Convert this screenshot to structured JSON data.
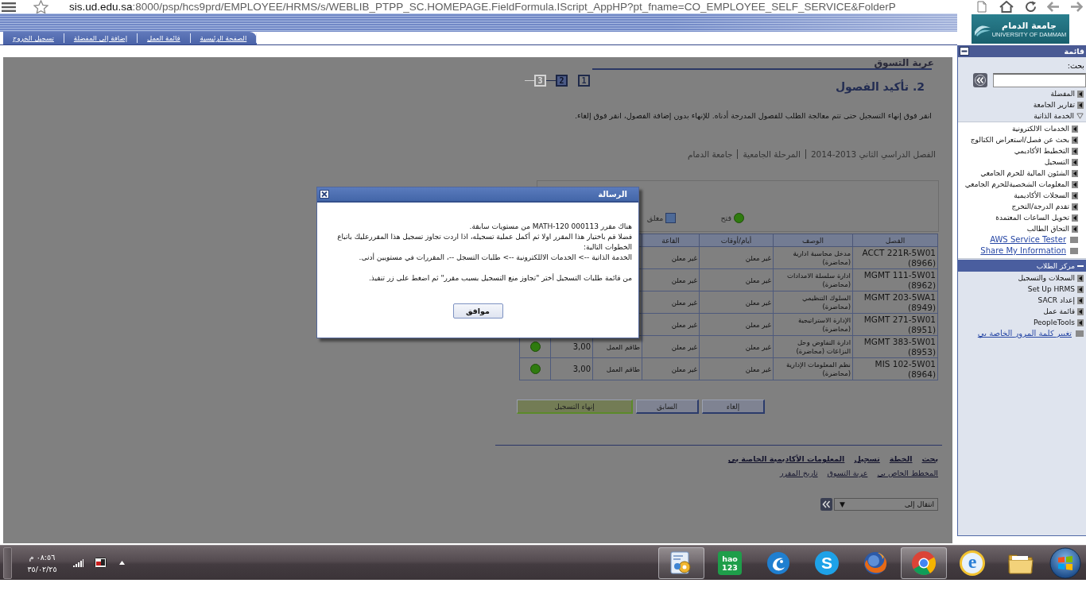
{
  "browser": {
    "url_host": "sis.ud.edu.sa",
    "url_path": ":8000/psp/hcs9prd/EMPLOYEE/HRMS/s/WEBLIB_PTPP_SC.HOMEPAGE.FieldFormula.IScript_AppHP?pt_fname=CO_EMPLOYEE_SELF_SERVICE&FolderP"
  },
  "header": {
    "logo": {
      "text": "جامعة الدمام",
      "subtitle": "UNIVERSITY OF DAMMAM"
    },
    "nav_links": [
      "الصفحة الرئيسية",
      "قائمة العمل",
      "إضافة إلى المفضلة",
      "تسجيل الخروج"
    ]
  },
  "page": {
    "title": "عربة التسوق",
    "heading": "2. تأكيد الفصول",
    "steps": [
      {
        "label": "1",
        "selected": false,
        "disabled": false
      },
      {
        "label": "2",
        "selected": true,
        "disabled": false
      },
      {
        "label": "3",
        "selected": false,
        "disabled": true
      }
    ],
    "instructions": "انقر فوق إنهاء التسجيل حتى تتم معالجة الطلب للفصول المدرجة أدناه. للإنهاء بدون إضافة الفصول، انقر فوق إلغاء.",
    "term": [
      "الفصل الدراسي الثاني 2013-2014",
      "المرحلة الجامعية",
      "جامعة الدمام"
    ],
    "legend": [
      {
        "kind": "open",
        "label": "فتح"
      },
      {
        "kind": "closed",
        "label": "مغلق"
      }
    ],
    "table": {
      "columns": [
        "الفصل",
        "الوصف",
        "أيام/أوقات",
        "القاعة"
      ],
      "rows": [
        {
          "class": "ACCT 221R-5W01 (8966)",
          "description": "مدخل محاسبة ادارية (محاضرة)",
          "days_times": "غير معلن",
          "room": "غير معلن"
        },
        {
          "class": "MGMT 111-5W01 (8962)",
          "description": "ادارة سلسلة الامدادات (محاضرة)",
          "days_times": "غير معلن",
          "room": "غير معلن"
        },
        {
          "class": "MGMT 203-5WA1 (8949)",
          "description": "السلوك التنظيمي (محاضرة)",
          "days_times": "غير معلن",
          "room": "غير معلن"
        },
        {
          "class": "MGMT 271-5W01 (8951)",
          "description": "الإدارة الاستراتيجية (محاضرة)",
          "days_times": "غير معلن",
          "room": "غير معلن"
        },
        {
          "class": "MGMT 383-5W01 (8953)",
          "description": "ادارة التفاوض وحل النزاعات (محاضرة)",
          "days_times": "غير معلن",
          "room": "غير معلن",
          "column_5": "طاقم العمل",
          "column_6": "3,00",
          "open": true
        },
        {
          "class": "MIS 102-5W01 (8964)",
          "description": "نظم المعلومات الإدارية (محاضرة)",
          "days_times": "غير معلن",
          "room": "غير معلن",
          "column_5": "طاقم العمل",
          "column_6": "3,00",
          "open": true
        }
      ]
    },
    "buttons": [
      {
        "label": "إلغاء",
        "kind": "secondary"
      },
      {
        "label": "السابق",
        "kind": "secondary"
      },
      {
        "label": "إنهاء التسجيل",
        "kind": "primary"
      }
    ],
    "link_rows": [
      {
        "kind": "bold",
        "links": [
          "بحث",
          "الخطة",
          "تسجيل",
          "المعلومات الأكاديمية الخاصة بي"
        ]
      },
      {
        "kind": "plain",
        "links": [
          "المخطط الخاص بي",
          "عربة التسوق",
          "تاريخ المقرر"
        ]
      }
    ],
    "jump": {
      "value": "انتقال إلى",
      "arrow": "▼"
    }
  },
  "dialog": {
    "title": "الرسالة",
    "paragraphs": [
      [
        "هناك مقرر MATH-120 000113 من مستويات سابقة.",
        "فضلا قم باختيار هذا المقرر اولا ثم أكمل عملية تسجيله، اذا اردت تجاوز تسجيل هذا المقررعليك باتباع الخطوات التالية:",
        "الخدمة الذاتية --> الخدمات الاللكترونية --> طلبات التسجل --، المقررات في مستويين أدنى."
      ],
      [
        "من قائمة طلبات التسجيل أختر \"تجاوز منع التسجيل بسبب مقرر\" ثم اضغط على زر تنفيذ."
      ]
    ],
    "button": "موافق"
  },
  "sidebar": {
    "title": "قائمة",
    "search_label": "بحث:",
    "items": [
      {
        "label": "المفضلة",
        "kind": "folder",
        "expanded": false,
        "selected": false
      },
      {
        "label": "تقارير الجامعة",
        "kind": "folder",
        "expanded": false,
        "selected": false
      },
      {
        "label": "الخدمة الذاتية",
        "kind": "folder",
        "expanded": true,
        "selected": false,
        "children": [
          {
            "label": "الخدمات الالكترونية",
            "kind": "folder",
            "expanded": false,
            "selected": false
          },
          {
            "label": "بحث عن فصل/استعراض الكتالوج",
            "kind": "folder",
            "expanded": false,
            "selected": false
          },
          {
            "label": "التخطيط الأكاديمي",
            "kind": "folder",
            "expanded": false,
            "selected": false
          },
          {
            "label": "التسجيل",
            "kind": "folder",
            "expanded": false,
            "selected": false
          },
          {
            "label": "الشئون المالية للحرم الجامعي",
            "kind": "folder",
            "expanded": false,
            "selected": false
          },
          {
            "label": "المعلومات الشخصيةللحرم الجامعي",
            "kind": "folder",
            "expanded": false,
            "selected": false
          },
          {
            "label": "السجلات الأكاديمية",
            "kind": "folder",
            "expanded": false,
            "selected": false
          },
          {
            "label": "تقدم الدرجة/التخرج",
            "kind": "folder",
            "expanded": false,
            "selected": false
          },
          {
            "label": "تحويل الساعات المعتمدة",
            "kind": "folder",
            "expanded": false,
            "selected": false
          },
          {
            "label": "التحاق الطالب",
            "kind": "folder",
            "expanded": false,
            "selected": false
          },
          {
            "label": "AWS Service Tester",
            "kind": "link",
            "expanded": false,
            "selected": false
          },
          {
            "label": "Share My Information",
            "kind": "link",
            "expanded": false,
            "selected": false
          }
        ]
      },
      {
        "label": "مركز الطلاب",
        "kind": "folder",
        "expanded": true,
        "selected": true
      },
      {
        "label": "السجلات والتسجيل",
        "kind": "folder",
        "expanded": false,
        "selected": false
      },
      {
        "label": "Set Up HRMS",
        "kind": "folder",
        "expanded": false,
        "selected": false
      },
      {
        "label": "إعداد SACR",
        "kind": "folder",
        "expanded": false,
        "selected": false
      },
      {
        "label": "قائمة عمل",
        "kind": "folder",
        "expanded": false,
        "selected": false
      },
      {
        "label": "PeopleTools",
        "kind": "folder",
        "expanded": false,
        "selected": false
      },
      {
        "label": "تغيير كلمة المرور الخاصة بي",
        "kind": "link",
        "expanded": false,
        "selected": false
      }
    ]
  },
  "taskbar": {
    "time": "٠٨:٥٦ م",
    "date": "٣٥/٠٢/٢٥",
    "apps": [
      {
        "kind": "folder",
        "running": false
      },
      {
        "kind": "letter-ring",
        "text": "e",
        "running": false
      },
      {
        "kind": "segmented-circle",
        "running": true
      },
      {
        "kind": "fox-globe",
        "running": false
      },
      {
        "kind": "letter-circle",
        "text": "S",
        "running": false
      },
      {
        "kind": "swirl",
        "running": false
      },
      {
        "kind": "text-tile",
        "text": "hao 123",
        "running": false
      },
      {
        "kind": "gear-document",
        "running": true
      }
    ]
  }
}
